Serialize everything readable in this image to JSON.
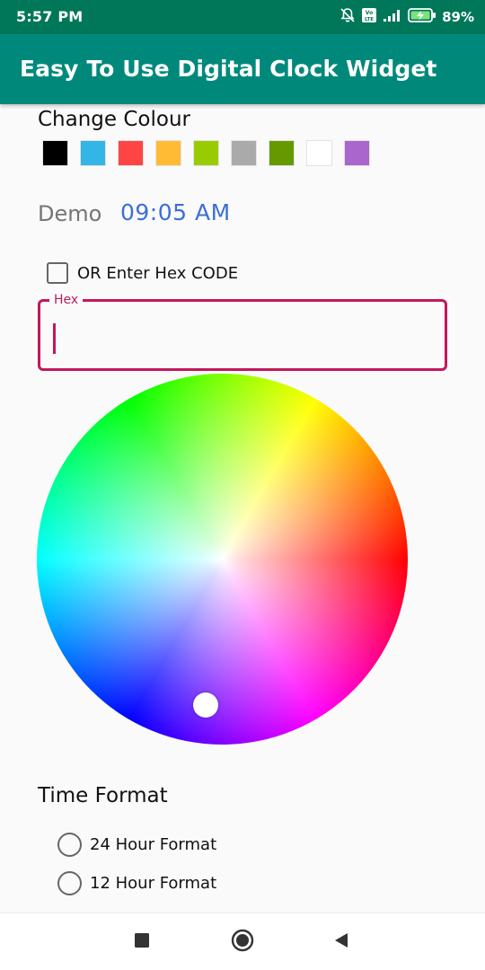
{
  "status_bar": {
    "time": "5:57 PM",
    "battery": "89%",
    "icons": [
      "mute-bell-icon",
      "volte-icon",
      "signal-icon",
      "battery-charging-icon"
    ]
  },
  "app_bar": {
    "title": "Easy To Use Digital Clock Widget"
  },
  "colour_section": {
    "title": "Change Colour",
    "swatches": [
      "#000000",
      "#33b5e5",
      "#ff4444",
      "#ffbb33",
      "#99cc00",
      "#aaaaaa",
      "#669900",
      "#ffffff",
      "#aa66cc"
    ]
  },
  "demo": {
    "label": "Demo",
    "time": "09:05 AM",
    "time_color": "#3b6fd8"
  },
  "hex_option": {
    "checkbox_label": "OR Enter Hex CODE",
    "checked": false,
    "field_label": "Hex",
    "value": "",
    "accent": "#c2185b"
  },
  "color_wheel": {
    "icon": "color-wheel"
  },
  "time_format": {
    "title": "Time Format",
    "options": [
      {
        "label": "24 Hour Format",
        "selected": false
      },
      {
        "label": "12 Hour Format",
        "selected": false
      }
    ]
  },
  "nav_bar": {
    "icons": [
      "recents-square-icon",
      "home-circle-icon",
      "back-triangle-icon"
    ]
  }
}
